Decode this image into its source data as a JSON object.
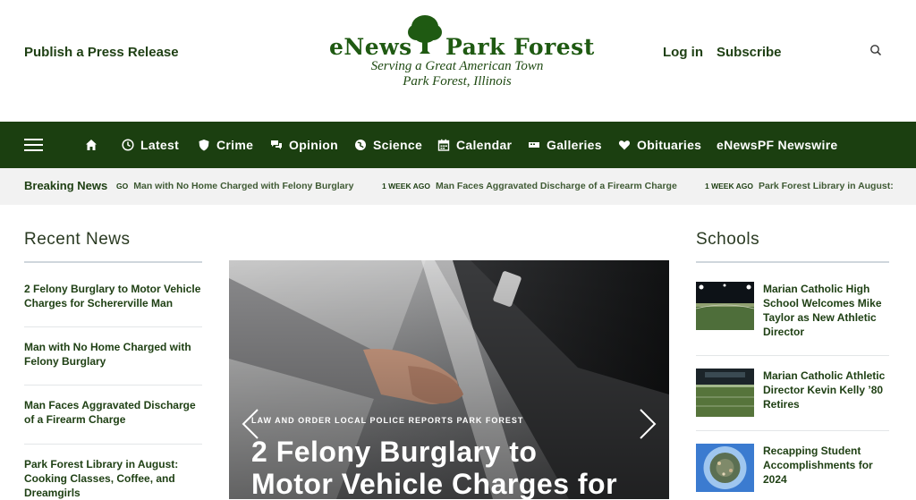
{
  "header": {
    "publish_label": "Publish a Press Release",
    "logo_left": "eNews",
    "logo_right": "Park Forest",
    "tagline_1": "Serving a Great American Town",
    "tagline_2": "Park Forest, Illinois",
    "login_label": "Log in",
    "subscribe_label": "Subscribe"
  },
  "nav": {
    "items": [
      {
        "label": ""
      },
      {
        "label": "Latest"
      },
      {
        "label": "Crime"
      },
      {
        "label": "Opinion"
      },
      {
        "label": "Science"
      },
      {
        "label": "Calendar"
      },
      {
        "label": "Galleries"
      },
      {
        "label": "Obituaries"
      },
      {
        "label": "eNewsPF Newswire"
      }
    ]
  },
  "breaking": {
    "label": "Breaking News",
    "items": [
      {
        "ago": "GO",
        "text": "Man with No Home Charged with Felony Burglary"
      },
      {
        "ago": "1 WEEK AGO",
        "text": "Man Faces Aggravated Discharge of a Firearm Charge"
      },
      {
        "ago": "1 WEEK AGO",
        "text": "Park Forest Library in August:"
      }
    ]
  },
  "recent": {
    "title": "Recent News",
    "items": [
      "2 Felony Burglary to Motor Vehicle Charges for Schererville Man",
      "Man with No Home Charged with Felony Burglary",
      "Man Faces Aggravated Discharge of a Firearm Charge",
      "Park Forest Library in August: Cooking Classes, Coffee, and Dreamgirls"
    ]
  },
  "hero": {
    "categories": "LAW AND ORDER  LOCAL POLICE REPORTS  PARK FOREST",
    "title": "2 Felony Burglary to Motor Vehicle Charges for"
  },
  "schools": {
    "title": "Schools",
    "items": [
      "Marian Catholic High School Welcomes Mike Taylor as New Athletic Director",
      "Marian Catholic Athletic Director Kevin Kelly ’80 Retires",
      "Recapping Student Accomplishments for 2024"
    ]
  },
  "colors": {
    "brand_green": "#1b3f10",
    "text_green": "#1f4014"
  }
}
